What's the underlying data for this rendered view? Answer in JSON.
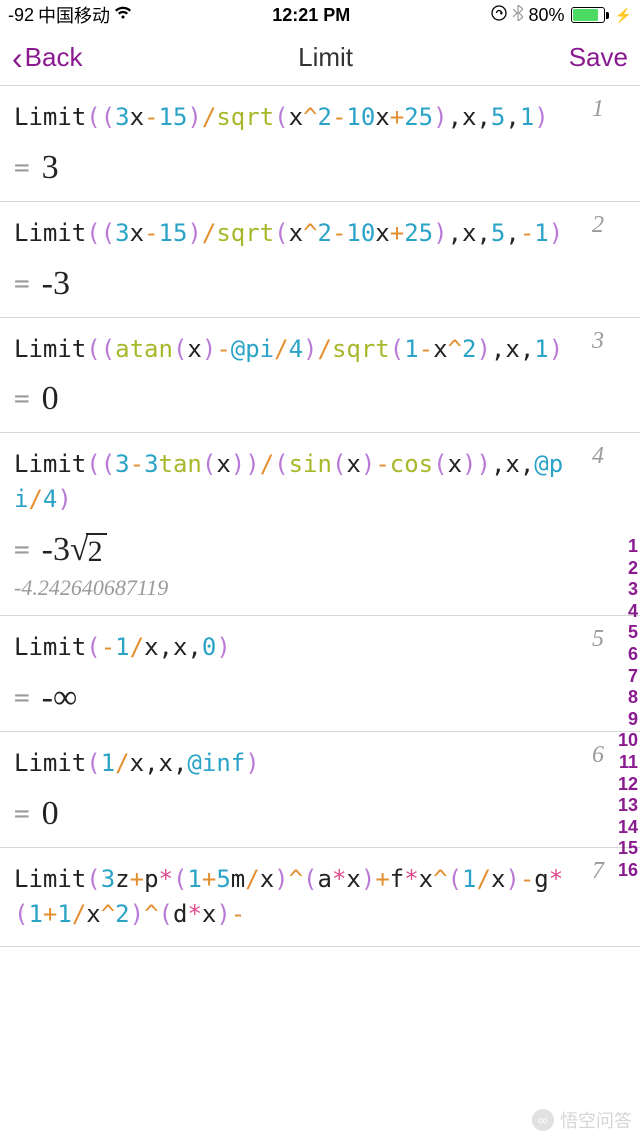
{
  "status": {
    "signal": "-92",
    "carrier": "中国移动",
    "time": "12:21 PM",
    "battery_pct": "80%"
  },
  "nav": {
    "back": "Back",
    "title": "Limit",
    "save": "Save"
  },
  "items": [
    {
      "num": "1",
      "tokens": [
        [
          "blk",
          "Limit"
        ],
        [
          "par",
          "("
        ],
        [
          "par",
          "("
        ],
        [
          "num",
          "3"
        ],
        [
          "blk",
          "x"
        ],
        [
          "op",
          "-"
        ],
        [
          "num",
          "15"
        ],
        [
          "par",
          ")"
        ],
        [
          "op",
          "/"
        ],
        [
          "fn",
          "sqrt"
        ],
        [
          "par",
          "("
        ],
        [
          "blk",
          "x"
        ],
        [
          "op",
          "^"
        ],
        [
          "num",
          "2"
        ],
        [
          "op",
          "-"
        ],
        [
          "num",
          "10"
        ],
        [
          "blk",
          "x"
        ],
        [
          "op",
          "+"
        ],
        [
          "num",
          "25"
        ],
        [
          "par",
          ")"
        ],
        [
          "blk",
          ","
        ],
        [
          "blk",
          "x"
        ],
        [
          "blk",
          ","
        ],
        [
          "num",
          "5"
        ],
        [
          "blk",
          ","
        ],
        [
          "num",
          "1"
        ],
        [
          "par",
          ")"
        ]
      ],
      "result_text": "3"
    },
    {
      "num": "2",
      "tokens": [
        [
          "blk",
          "Limit"
        ],
        [
          "par",
          "("
        ],
        [
          "par",
          "("
        ],
        [
          "num",
          "3"
        ],
        [
          "blk",
          "x"
        ],
        [
          "op",
          "-"
        ],
        [
          "num",
          "15"
        ],
        [
          "par",
          ")"
        ],
        [
          "op",
          "/"
        ],
        [
          "fn",
          "sqrt"
        ],
        [
          "par",
          "("
        ],
        [
          "blk",
          "x"
        ],
        [
          "op",
          "^"
        ],
        [
          "num",
          "2"
        ],
        [
          "op",
          "-"
        ],
        [
          "num",
          "10"
        ],
        [
          "blk",
          "x"
        ],
        [
          "op",
          "+"
        ],
        [
          "num",
          "25"
        ],
        [
          "par",
          ")"
        ],
        [
          "blk",
          ","
        ],
        [
          "blk",
          "x"
        ],
        [
          "blk",
          ","
        ],
        [
          "num",
          "5"
        ],
        [
          "blk",
          ","
        ],
        [
          "op",
          "-"
        ],
        [
          "num",
          "1"
        ],
        [
          "par",
          ")"
        ]
      ],
      "result_text": "-3"
    },
    {
      "num": "3",
      "tokens": [
        [
          "blk",
          "Limit"
        ],
        [
          "par",
          "("
        ],
        [
          "par",
          "("
        ],
        [
          "fn",
          "atan"
        ],
        [
          "par",
          "("
        ],
        [
          "blk",
          "x"
        ],
        [
          "par",
          ")"
        ],
        [
          "op",
          "-"
        ],
        [
          "at",
          "@pi"
        ],
        [
          "op",
          "/"
        ],
        [
          "num",
          "4"
        ],
        [
          "par",
          ")"
        ],
        [
          "op",
          "/"
        ],
        [
          "fn",
          "sqrt"
        ],
        [
          "par",
          "("
        ],
        [
          "num",
          "1"
        ],
        [
          "op",
          "-"
        ],
        [
          "blk",
          "x"
        ],
        [
          "op",
          "^"
        ],
        [
          "num",
          "2"
        ],
        [
          "par",
          ")"
        ],
        [
          "blk",
          ","
        ],
        [
          "blk",
          "x"
        ],
        [
          "blk",
          ","
        ],
        [
          "num",
          "1"
        ],
        [
          "par",
          ")"
        ]
      ],
      "result_text": "0"
    },
    {
      "num": "4",
      "tokens": [
        [
          "blk",
          "Limit"
        ],
        [
          "par",
          "("
        ],
        [
          "par",
          "("
        ],
        [
          "num",
          "3"
        ],
        [
          "op",
          "-"
        ],
        [
          "num",
          "3"
        ],
        [
          "fn",
          "tan"
        ],
        [
          "par",
          "("
        ],
        [
          "blk",
          "x"
        ],
        [
          "par",
          ")"
        ],
        [
          "par",
          ")"
        ],
        [
          "op",
          "/"
        ],
        [
          "par",
          "("
        ],
        [
          "fn",
          "sin"
        ],
        [
          "par",
          "("
        ],
        [
          "blk",
          "x"
        ],
        [
          "par",
          ")"
        ],
        [
          "op",
          "-"
        ],
        [
          "fn",
          "cos"
        ],
        [
          "par",
          "("
        ],
        [
          "blk",
          "x"
        ],
        [
          "par",
          ")"
        ],
        [
          "par",
          ")"
        ],
        [
          "blk",
          ","
        ],
        [
          "blk",
          "x"
        ],
        [
          "blk",
          ","
        ],
        [
          "at",
          "@pi"
        ],
        [
          "op",
          "/"
        ],
        [
          "num",
          "4"
        ],
        [
          "par",
          ")"
        ]
      ],
      "result_prefix": "-3",
      "result_radicand": "2",
      "approx": "-4.242640687119"
    },
    {
      "num": "5",
      "tokens": [
        [
          "blk",
          "Limit"
        ],
        [
          "par",
          "("
        ],
        [
          "op",
          "-"
        ],
        [
          "num",
          "1"
        ],
        [
          "op",
          "/"
        ],
        [
          "blk",
          "x"
        ],
        [
          "blk",
          ","
        ],
        [
          "blk",
          "x"
        ],
        [
          "blk",
          ","
        ],
        [
          "num",
          "0"
        ],
        [
          "par",
          ")"
        ]
      ],
      "result_text": "-∞"
    },
    {
      "num": "6",
      "tokens": [
        [
          "blk",
          "Limit"
        ],
        [
          "par",
          "("
        ],
        [
          "num",
          "1"
        ],
        [
          "op",
          "/"
        ],
        [
          "blk",
          "x"
        ],
        [
          "blk",
          ","
        ],
        [
          "blk",
          "x"
        ],
        [
          "blk",
          ","
        ],
        [
          "at",
          "@inf"
        ],
        [
          "par",
          ")"
        ]
      ],
      "result_text": "0"
    },
    {
      "num": "7",
      "tokens": [
        [
          "blk",
          "Limit"
        ],
        [
          "par",
          "("
        ],
        [
          "num",
          "3"
        ],
        [
          "blk",
          "z"
        ],
        [
          "op",
          "+"
        ],
        [
          "blk",
          "p"
        ],
        [
          "kw",
          "*"
        ],
        [
          "par",
          "("
        ],
        [
          "num",
          "1"
        ],
        [
          "op",
          "+"
        ],
        [
          "num",
          "5"
        ],
        [
          "blk",
          "m"
        ],
        [
          "op",
          "/"
        ],
        [
          "blk",
          "x"
        ],
        [
          "par",
          ")"
        ],
        [
          "op",
          "^"
        ],
        [
          "par",
          "("
        ],
        [
          "blk",
          "a"
        ],
        [
          "kw",
          "*"
        ],
        [
          "blk",
          "x"
        ],
        [
          "par",
          ")"
        ],
        [
          "op",
          "+"
        ],
        [
          "blk",
          "f"
        ],
        [
          "kw",
          "*"
        ],
        [
          "blk",
          "x"
        ],
        [
          "op",
          "^"
        ],
        [
          "par",
          "("
        ],
        [
          "num",
          "1"
        ],
        [
          "op",
          "/"
        ],
        [
          "blk",
          "x"
        ],
        [
          "par",
          ")"
        ],
        [
          "op",
          "-"
        ],
        [
          "blk",
          "g"
        ],
        [
          "kw",
          "*"
        ],
        [
          "par",
          "("
        ],
        [
          "num",
          "1"
        ],
        [
          "op",
          "+"
        ],
        [
          "num",
          "1"
        ],
        [
          "op",
          "/"
        ],
        [
          "blk",
          "x"
        ],
        [
          "op",
          "^"
        ],
        [
          "num",
          "2"
        ],
        [
          "par",
          ")"
        ],
        [
          "op",
          "^"
        ],
        [
          "par",
          "("
        ],
        [
          "blk",
          "d"
        ],
        [
          "kw",
          "*"
        ],
        [
          "blk",
          "x"
        ],
        [
          "par",
          ")"
        ],
        [
          "op",
          "-"
        ]
      ]
    }
  ],
  "side_index": [
    "1",
    "2",
    "3",
    "4",
    "5",
    "6",
    "7",
    "8",
    "9",
    "10",
    "11",
    "12",
    "13",
    "14",
    "15",
    "16"
  ],
  "watermark": "悟空问答"
}
